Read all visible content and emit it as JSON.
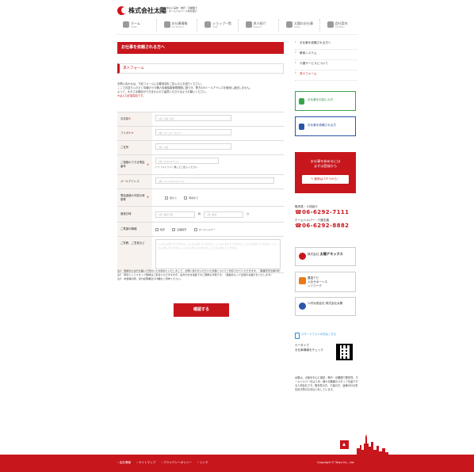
{
  "header": {
    "logo_text": "株式会社太陽",
    "tagline_1": "太陽を中心に実技・神戸・近畿圏で",
    "tagline_2": "販売員・ホームヘルパー人材を紹介"
  },
  "gnav": [
    {
      "label": "ホーム",
      "sub": "HOME",
      "icon": "home-icon"
    },
    {
      "label": "お仕事情報",
      "sub": "JOB SEARCH",
      "icon": "document-icon"
    },
    {
      "label": "ショップ一覧",
      "sub": "SHOP",
      "icon": "shop-icon"
    },
    {
      "label": "求人紹介",
      "sub": "RECRUIT",
      "icon": "people-icon"
    },
    {
      "label": "太陽のお仕事",
      "sub": "WORK",
      "icon": "group-icon"
    },
    {
      "label": "会社案内",
      "sub": "COMPANY",
      "icon": "building-icon"
    }
  ],
  "main": {
    "heading": "お仕事を依頼される方へ",
    "form_title": "求人フォーム",
    "intro_1": "お問い合わせは、下記フォームに必要事項をご記入の上お送りください。",
    "intro_2": "ここでお送りいただく情報のうち職人情報保護管理規程に基づき、弊方のEメールアドレスを使用し返信しません。",
    "intro_3": "よって、大きさ太陽自ができませんので留意いただけるようお願いください。",
    "intro_req": "※は入力必須項目です。",
    "fields": [
      {
        "label": "お名前",
        "req": "※",
        "placeholder": "(例) 太陽 太郎"
      },
      {
        "label": "フリガナ",
        "req": "※",
        "placeholder": "(例) タイヨウ タロウ"
      },
      {
        "label": "ご住所",
        "req": "",
        "placeholder": "(例) 大阪"
      },
      {
        "label": "ご連絡のできる電話番号",
        "req": "※",
        "placeholder": "(例) 0662927111",
        "note": "(ー)（ハイフン）無しでご記入ください"
      },
      {
        "label": "メールアドレス",
        "req": "",
        "placeholder": "(例) xxxxx@xxxxxx.jp"
      },
      {
        "label": "電話連絡の可能な時間帯",
        "req": "※",
        "options": [
          "昼から",
          "時頃まで"
        ]
      },
      {
        "label": "面接日時",
        "req": "",
        "placeholder_a": "(例) 面接日時",
        "mid": "時",
        "placeholder_b": "(例) 面談",
        "suffix": "分"
      },
      {
        "label": "ご希望の職種",
        "req": "",
        "options": [
          "販売",
          "店舗販売",
          "ホームヘルパー"
        ]
      },
      {
        "label": "ご質問、ご意見など",
        "req": "",
        "placeholder": "ここに入力してください。ここに入力してください。ここに入力してください。ここに入力してください。ここに入力してください。ここに入力してください。ここに入力してください。"
      }
    ],
    "notes": [
      "注1　登録または行き届いて気付いたお勧めにいたしまして、お問い合わせいただいた内容についてご対応させていただきます。（職業安定法第5条）",
      "注2　原則としてスタッフ登録はご来社いただきますが、遠方の方は電話でのご登録も可能です。（連絡をもって出勤のお届けをいたします）",
      "注3　本登録の際、身分証明書及び印鑑をご持参ください。"
    ],
    "submit_label": "確認する"
  },
  "sidebar": {
    "links": [
      {
        "label": "お仕事を依頼される方へ",
        "active": false
      },
      {
        "label": "教育システム",
        "active": false
      },
      {
        "label": "介護サービスについて",
        "active": false
      },
      {
        "label": "求人フォーム",
        "active": true
      }
    ],
    "jobs_box": "お仕事をお探しの方",
    "work_box": "お仕事を依頼される方",
    "reg_line_1": "お仕事を始めるには",
    "reg_line_2": "まずは登録から",
    "reg_button": "登録はコチラから！",
    "contact_1_label": "販売員・人材紹介",
    "contact_1_num": "☎06-6292-7111",
    "contact_2_label": "ホームヘルパー・介護支援",
    "contact_2_num": "☎06-6292-8882",
    "banner_1_small": "株式会社",
    "banner_1_main": "太陽アネックス",
    "banner_2_line_1": "豊富アピ",
    "banner_2_line_2": "入社サポートネ",
    "banner_2_line_3": "ットワーク",
    "banner_3": "人材派遣会社 株式会社太陽",
    "mobile_title": "スマートフォンの方はこちら",
    "mobile_line_1": "ケータイで",
    "mobile_line_2": "お仕事情報をチェック",
    "about": "太陽は、大阪を中心に実技・神戸・近畿圏で販売員、ホームヘルパーをはじめ、様々な職種のスタッフを紹介する人材会社です。販売員の方、介護の方、皆様がお仕事を探す際のお手伝いをしています。"
  },
  "footer": {
    "links": [
      "› 会社情報",
      "› サイトマップ",
      "› プライバシーポリシー",
      "› リンク"
    ],
    "copyright": "Copyright © Taiyo Co., Ltd."
  },
  "colors": {
    "accent": "#c8161d"
  }
}
